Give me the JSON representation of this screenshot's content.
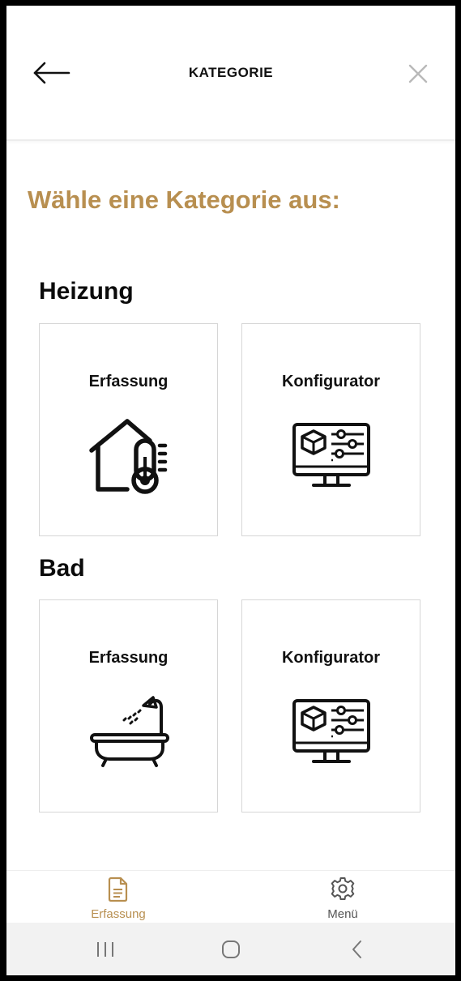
{
  "header": {
    "title": "KATEGORIE"
  },
  "prompt": "Wähle eine Kategorie aus:",
  "sections": [
    {
      "title": "Heizung",
      "cards": [
        {
          "label": "Erfassung",
          "icon": "house-thermometer-icon"
        },
        {
          "label": "Konfigurator",
          "icon": "monitor-configurator-icon"
        }
      ]
    },
    {
      "title": "Bad",
      "cards": [
        {
          "label": "Erfassung",
          "icon": "bathtub-shower-icon"
        },
        {
          "label": "Konfigurator",
          "icon": "monitor-configurator-icon"
        }
      ]
    }
  ],
  "bottom_nav": [
    {
      "label": "Erfassung",
      "icon": "document-icon",
      "active": true
    },
    {
      "label": "Menü",
      "icon": "gear-icon",
      "active": false
    }
  ],
  "colors": {
    "accent": "#b88f50",
    "inactive": "#555555",
    "text": "#111111"
  }
}
